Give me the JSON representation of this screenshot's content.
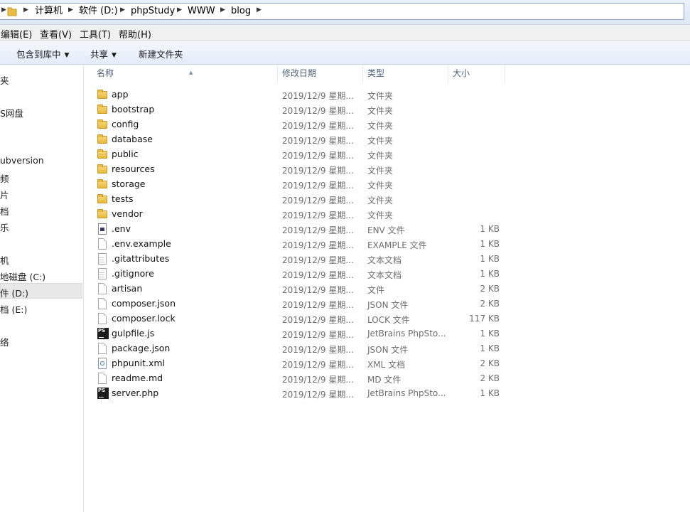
{
  "breadcrumb": [
    "计算机",
    "软件 (D:)",
    "phpStudy",
    "WWW",
    "blog"
  ],
  "menu": [
    "编辑(E)",
    "查看(V)",
    "工具(T)",
    "帮助(H)"
  ],
  "toolbar": {
    "include_library": "包含到库中",
    "share": "共享",
    "new_folder": "新建文件夹"
  },
  "nav": [
    "夹",
    "S网盘",
    "ubversion",
    "频",
    "片",
    "档",
    "乐",
    "机",
    "地磁盘 (C:)",
    "件 (D:)",
    "档 (E:)",
    "络"
  ],
  "columns": {
    "name": "名称",
    "date": "修改日期",
    "type": "类型",
    "size": "大小"
  },
  "files": [
    {
      "name": "app",
      "date": "2019/12/9 星期...",
      "type": "文件夹",
      "size": "",
      "icon": "folder-icon"
    },
    {
      "name": "bootstrap",
      "date": "2019/12/9 星期...",
      "type": "文件夹",
      "size": "",
      "icon": "folder-icon"
    },
    {
      "name": "config",
      "date": "2019/12/9 星期...",
      "type": "文件夹",
      "size": "",
      "icon": "folder-icon"
    },
    {
      "name": "database",
      "date": "2019/12/9 星期...",
      "type": "文件夹",
      "size": "",
      "icon": "folder-icon"
    },
    {
      "name": "public",
      "date": "2019/12/9 星期...",
      "type": "文件夹",
      "size": "",
      "icon": "folder-icon"
    },
    {
      "name": "resources",
      "date": "2019/12/9 星期...",
      "type": "文件夹",
      "size": "",
      "icon": "folder-icon"
    },
    {
      "name": "storage",
      "date": "2019/12/9 星期...",
      "type": "文件夹",
      "size": "",
      "icon": "folder-icon"
    },
    {
      "name": "tests",
      "date": "2019/12/9 星期...",
      "type": "文件夹",
      "size": "",
      "icon": "folder-icon"
    },
    {
      "name": "vendor",
      "date": "2019/12/9 星期...",
      "type": "文件夹",
      "size": "",
      "icon": "folder-icon"
    },
    {
      "name": ".env",
      "date": "2019/12/9 星期...",
      "type": "ENV 文件",
      "size": "1 KB",
      "icon": "env-file-icon"
    },
    {
      "name": ".env.example",
      "date": "2019/12/9 星期...",
      "type": "EXAMPLE 文件",
      "size": "1 KB",
      "icon": "file-icon"
    },
    {
      "name": ".gitattributes",
      "date": "2019/12/9 星期...",
      "type": "文本文档",
      "size": "1 KB",
      "icon": "text-file-icon"
    },
    {
      "name": ".gitignore",
      "date": "2019/12/9 星期...",
      "type": "文本文档",
      "size": "1 KB",
      "icon": "text-file-icon"
    },
    {
      "name": "artisan",
      "date": "2019/12/9 星期...",
      "type": "文件",
      "size": "2 KB",
      "icon": "file-icon"
    },
    {
      "name": "composer.json",
      "date": "2019/12/9 星期...",
      "type": "JSON 文件",
      "size": "2 KB",
      "icon": "file-icon"
    },
    {
      "name": "composer.lock",
      "date": "2019/12/9 星期...",
      "type": "LOCK 文件",
      "size": "117 KB",
      "icon": "file-icon"
    },
    {
      "name": "gulpfile.js",
      "date": "2019/12/9 星期...",
      "type": "JetBrains PhpSto...",
      "size": "1 KB",
      "icon": "phpstorm-icon"
    },
    {
      "name": "package.json",
      "date": "2019/12/9 星期...",
      "type": "JSON 文件",
      "size": "1 KB",
      "icon": "file-icon"
    },
    {
      "name": "phpunit.xml",
      "date": "2019/12/9 星期...",
      "type": "XML 文档",
      "size": "2 KB",
      "icon": "xml-file-icon"
    },
    {
      "name": "readme.md",
      "date": "2019/12/9 星期...",
      "type": "MD 文件",
      "size": "2 KB",
      "icon": "file-icon"
    },
    {
      "name": "server.php",
      "date": "2019/12/9 星期...",
      "type": "JetBrains PhpSto...",
      "size": "1 KB",
      "icon": "phpstorm-icon"
    }
  ],
  "colors": {
    "toolbar_bg": "#e3ecf8",
    "selected_nav": "#e8e8e8",
    "header_text": "#4c607a",
    "folder_yellow": "#e8b838"
  }
}
